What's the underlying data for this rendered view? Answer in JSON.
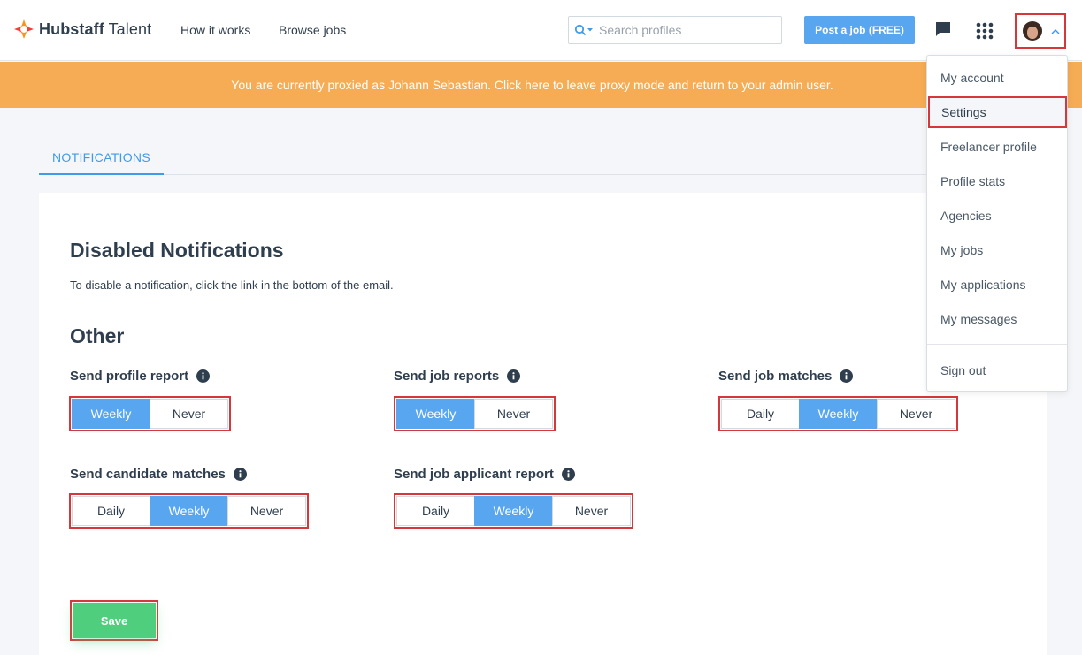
{
  "header": {
    "logo_brand": "Hubstaff",
    "logo_suffix": "Talent",
    "nav": [
      {
        "label": "How it works"
      },
      {
        "label": "Browse jobs"
      }
    ],
    "search": {
      "placeholder": "Search profiles",
      "icon": "search-icon"
    },
    "post_job_label": "Post a job (FREE)",
    "icons": [
      "message-icon",
      "apps-grid-icon",
      "chevron-up-icon"
    ]
  },
  "banner": {
    "text": "You are currently proxied as Johann Sebastian. Click here to leave proxy mode and return to your admin user."
  },
  "tabs": [
    {
      "label": "NOTIFICATIONS",
      "active": true
    }
  ],
  "content": {
    "disabled_title": "Disabled Notifications",
    "disabled_text": "To disable a notification, click the link in the bottom of the email.",
    "other_title": "Other",
    "settings": [
      {
        "label": "Send profile report",
        "options": [
          "Weekly",
          "Never"
        ],
        "selected": "Weekly"
      },
      {
        "label": "Send job reports",
        "options": [
          "Weekly",
          "Never"
        ],
        "selected": "Weekly"
      },
      {
        "label": "Send job matches",
        "options": [
          "Daily",
          "Weekly",
          "Never"
        ],
        "selected": "Weekly"
      },
      {
        "label": "Send candidate matches",
        "options": [
          "Daily",
          "Weekly",
          "Never"
        ],
        "selected": "Weekly"
      },
      {
        "label": "Send job applicant report",
        "options": [
          "Daily",
          "Weekly",
          "Never"
        ],
        "selected": "Weekly"
      }
    ],
    "save_label": "Save"
  },
  "dropdown": {
    "items": [
      {
        "label": "My account"
      },
      {
        "label": "Settings",
        "highlighted": true
      },
      {
        "label": "Freelancer profile"
      },
      {
        "label": "Profile stats"
      },
      {
        "label": "Agencies"
      },
      {
        "label": "My jobs"
      },
      {
        "label": "My applications"
      },
      {
        "label": "My messages"
      }
    ],
    "sign_out_label": "Sign out"
  },
  "colors": {
    "accent": "#58a6f0",
    "banner": "#f5ac54",
    "save": "#4fce7e",
    "highlight_border": "#d6373a"
  }
}
